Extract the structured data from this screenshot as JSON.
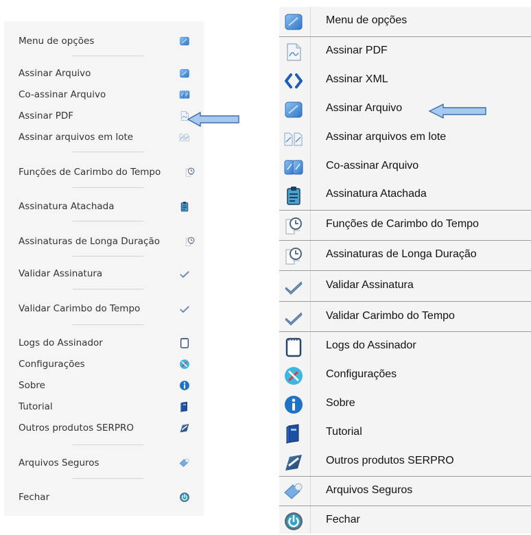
{
  "left_menu": {
    "items": [
      {
        "label": "Menu de opções",
        "icon": "doc-sign-icon"
      },
      {
        "label": "Assinar Arquivo",
        "icon": "doc-sign-icon"
      },
      {
        "label": "Co-assinar Arquivo",
        "icon": "co-sign-icon"
      },
      {
        "label": "Assinar PDF",
        "icon": "pdf-icon"
      },
      {
        "label": "Assinar arquivos em lote",
        "icon": "batch-icon"
      },
      {
        "label": "Funções de Carimbo do Tempo",
        "icon": "timestamp-icon"
      },
      {
        "label": "Assinatura Atachada",
        "icon": "clipboard-icon"
      },
      {
        "label": "Assinaturas de Longa Duração",
        "icon": "timestamp-icon"
      },
      {
        "label": "Validar Assinatura",
        "icon": "check-icon"
      },
      {
        "label": "Validar Carimbo do Tempo",
        "icon": "check-icon"
      },
      {
        "label": "Logs do Assinador",
        "icon": "notepad-icon"
      },
      {
        "label": "Configurações",
        "icon": "settings-icon"
      },
      {
        "label": "Sobre",
        "icon": "info-icon"
      },
      {
        "label": "Tutorial",
        "icon": "book-icon"
      },
      {
        "label": "Outros produtos SERPRO",
        "icon": "serpro-icon"
      },
      {
        "label": "Arquivos Seguros",
        "icon": "secure-files-icon"
      },
      {
        "label": "Fechar",
        "icon": "power-icon"
      }
    ]
  },
  "right_menu": {
    "items": [
      {
        "label": "Menu de opções",
        "icon": "doc-sign-icon"
      },
      {
        "label": "Assinar PDF",
        "icon": "pdf-icon"
      },
      {
        "label": "Assinar XML",
        "icon": "xml-icon"
      },
      {
        "label": "Assinar Arquivo",
        "icon": "doc-sign-icon"
      },
      {
        "label": "Assinar arquivos em lote",
        "icon": "batch-icon"
      },
      {
        "label": "Co-assinar Arquivo",
        "icon": "co-sign-icon"
      },
      {
        "label": "Assinatura Atachada",
        "icon": "clipboard-icon"
      },
      {
        "label": "Funções de Carimbo do Tempo",
        "icon": "timestamp-icon"
      },
      {
        "label": "Assinaturas de Longa Duração",
        "icon": "timestamp-icon"
      },
      {
        "label": "Validar Assinatura",
        "icon": "check-icon"
      },
      {
        "label": "Validar Carimbo do Tempo",
        "icon": "check-icon"
      },
      {
        "label": "Logs do Assinador",
        "icon": "notepad-icon"
      },
      {
        "label": "Configurações",
        "icon": "settings-icon"
      },
      {
        "label": "Sobre",
        "icon": "info-icon"
      },
      {
        "label": "Tutorial",
        "icon": "book-icon"
      },
      {
        "label": "Outros produtos SERPRO",
        "icon": "serpro-icon"
      },
      {
        "label": "Arquivos Seguros",
        "icon": "secure-files-icon"
      },
      {
        "label": "Fechar",
        "icon": "power-icon"
      }
    ]
  },
  "colors": {
    "arrow_fill": "#a9c8ee",
    "arrow_stroke": "#3a6db0",
    "icon_blue": "#4a8fd6",
    "separator": "#9a9a9a"
  }
}
